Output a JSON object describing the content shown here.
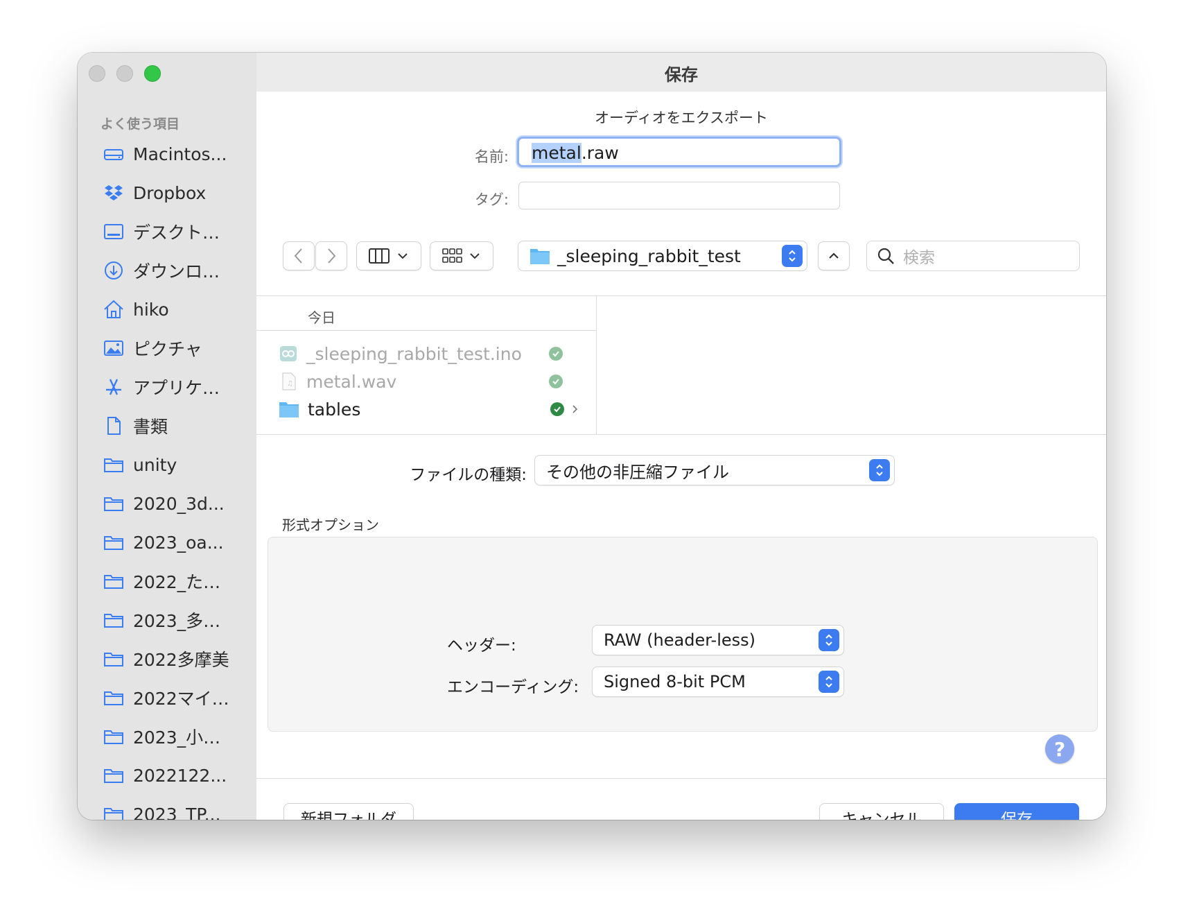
{
  "window": {
    "title": "保存"
  },
  "sidebar": {
    "section_title": "よく使う項目",
    "items": [
      {
        "label": "Macintos...",
        "icon": "drive-icon"
      },
      {
        "label": "Dropbox",
        "icon": "dropbox-icon"
      },
      {
        "label": "デスクト…",
        "icon": "desktop-icon"
      },
      {
        "label": "ダウンロ…",
        "icon": "download-icon"
      },
      {
        "label": "hiko",
        "icon": "home-icon"
      },
      {
        "label": "ピクチャ",
        "icon": "pictures-icon"
      },
      {
        "label": "アプリケ…",
        "icon": "applications-icon"
      },
      {
        "label": "書類",
        "icon": "document-icon"
      },
      {
        "label": "unity",
        "icon": "folder-icon"
      },
      {
        "label": "2020_3d...",
        "icon": "folder-icon"
      },
      {
        "label": "2023_oa...",
        "icon": "folder-icon"
      },
      {
        "label": "2022_た…",
        "icon": "folder-icon"
      },
      {
        "label": "2023_多…",
        "icon": "folder-icon"
      },
      {
        "label": "2022多摩美",
        "icon": "folder-icon"
      },
      {
        "label": "2022マイ…",
        "icon": "folder-icon"
      },
      {
        "label": "2023_小…",
        "icon": "folder-icon"
      },
      {
        "label": "2022122...",
        "icon": "folder-icon"
      },
      {
        "label": "2023_TP...",
        "icon": "folder-icon"
      }
    ]
  },
  "dialog": {
    "subtitle": "オーディオをエクスポート",
    "name_label": "名前:",
    "name_selected": "metal",
    "name_rest": ".raw",
    "tags_label": "タグ:"
  },
  "toolbar": {
    "path": "_sleeping_rabbit_test",
    "search_placeholder": "検索"
  },
  "browser": {
    "group": "今日",
    "files": [
      {
        "name": "_sleeping_rabbit_test.ino",
        "enabled": false,
        "icon": "arduino-file-icon"
      },
      {
        "name": "metal.wav",
        "enabled": false,
        "icon": "audio-file-icon"
      },
      {
        "name": "tables",
        "enabled": true,
        "icon": "folder-icon"
      }
    ]
  },
  "format": {
    "file_type_label": "ファイルの種類:",
    "file_type_value": "その他の非圧縮ファイル",
    "options_title": "形式オプション",
    "header_label": "ヘッダー:",
    "header_value": "RAW (header-less)",
    "encoding_label": "エンコーディング:",
    "encoding_value": "Signed 8-bit PCM",
    "help": "?"
  },
  "footer": {
    "new_folder": "新規フォルダ",
    "cancel": "キャンセル",
    "save": "保存"
  },
  "colors": {
    "accent": "#3d7cf0",
    "sync_check": "#2f8a45",
    "sync_check_dim": "#8fc29c"
  }
}
